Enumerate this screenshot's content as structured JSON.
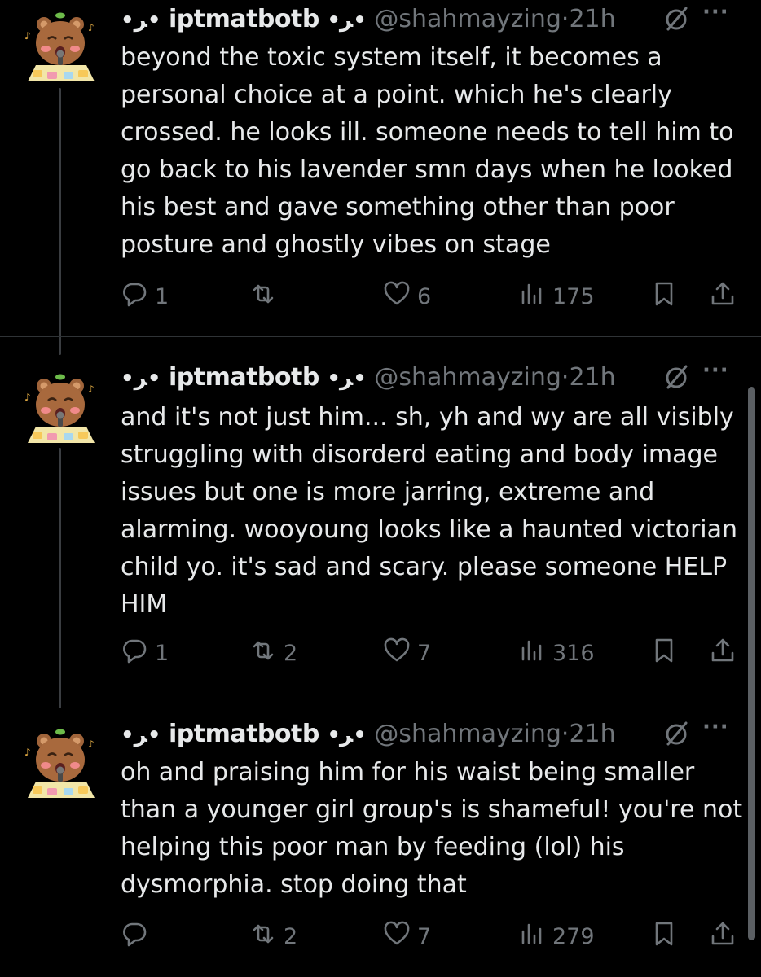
{
  "tweets": [
    {
      "deco_left": "•ﺮ•",
      "display_name": "iptmatbotb",
      "deco_right": "•ﺮ•",
      "handle": "@shahmayzing",
      "dot": "·",
      "time": "21h",
      "more": "···",
      "text": "beyond the toxic system itself, it becomes a personal choice at a point. which he's clearly crossed. he looks ill. someone needs to tell him to go back to his lavender smn days when he looked his best and gave something other than poor posture and ghostly vibes on stage",
      "stats": {
        "replies": "1",
        "reposts": "",
        "likes": "6",
        "views": "175"
      }
    },
    {
      "deco_left": "•ﺮ•",
      "display_name": "iptmatbotb",
      "deco_right": "•ﺮ•",
      "handle": "@shahmayzing",
      "dot": "·",
      "time": "21h",
      "more": "···",
      "text": "and it's not just him... sh, yh and wy are all visibly struggling with disorderd eating and body image issues but one is more jarring, extreme and alarming. wooyoung looks like a haunted victorian child yo. it's sad and scary. please someone HELP HIM",
      "stats": {
        "replies": "1",
        "reposts": "2",
        "likes": "7",
        "views": "316"
      }
    },
    {
      "deco_left": "•ﺮ•",
      "display_name": "iptmatbotb",
      "deco_right": "•ﺮ•",
      "handle": "@shahmayzing",
      "dot": "·",
      "time": "21h",
      "more": "···",
      "text": "oh and praising him for his waist being smaller than a younger girl group's is shameful! you're not helping this poor man by feeding (lol) his dysmorphia. stop doing that",
      "stats": {
        "replies": "",
        "reposts": "2",
        "likes": "7",
        "views": "279"
      }
    }
  ],
  "icons": [
    "reply-icon",
    "repost-icon",
    "like-icon",
    "views-icon",
    "bookmark-icon",
    "share-icon",
    "grok-icon",
    "more-icon"
  ],
  "colors": {
    "background": "#000000",
    "text": "#e7e9ea",
    "muted": "#71767b",
    "divider": "#2f3336"
  }
}
